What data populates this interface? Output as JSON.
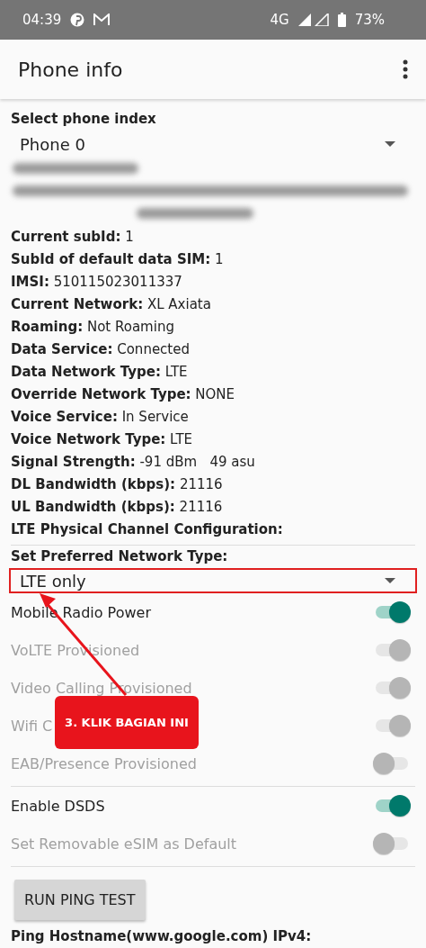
{
  "status_bar": {
    "time": "04:39",
    "network": "4G",
    "battery": "73%"
  },
  "app_bar": {
    "title": "Phone info"
  },
  "phone_index": {
    "label": "Select phone index",
    "value": "Phone 0"
  },
  "info_rows": [
    {
      "text": "**Current subId:** 1"
    },
    {
      "text": "**SubId of default data SIM:** 1"
    },
    {
      "text": "**IMSI:** 510115023011337"
    },
    {
      "text": "**Current Network:** XL Axiata"
    },
    {
      "text": "**Roaming:** Not Roaming"
    },
    {
      "text": "**Data Service:** Connected"
    },
    {
      "text": "**Data Network Type:** LTE"
    },
    {
      "text": "**Override Network Type:** NONE"
    },
    {
      "text": "**Voice Service:** In Service"
    },
    {
      "text": "**Voice Network Type:** LTE"
    },
    {
      "text": "**Signal Strength:** -91 dBm   49 asu"
    },
    {
      "text": "**DL Bandwidth (kbps):** 21116"
    },
    {
      "text": "**UL Bandwidth (kbps):** 21116"
    },
    {
      "text": "**LTE Physical Channel Configuration:**"
    }
  ],
  "preferred_network": {
    "label": "Set Preferred Network Type:",
    "value": "LTE only"
  },
  "toggles": [
    {
      "label": "Mobile Radio Power",
      "on": true,
      "disabled": false,
      "divider": false
    },
    {
      "label": "VoLTE Provisioned",
      "on": true,
      "disabled": true,
      "divider": false
    },
    {
      "label": "Video Calling Provisioned",
      "on": true,
      "disabled": true,
      "divider": false
    },
    {
      "label": "Wifi C",
      "on": true,
      "disabled": true,
      "divider": false
    },
    {
      "label": "EAB/Presence Provisioned",
      "on": false,
      "disabled": true,
      "divider": true
    },
    {
      "label": "Enable DSDS",
      "on": true,
      "disabled": false,
      "divider": false
    },
    {
      "label": "Set Removable eSIM as Default",
      "on": false,
      "disabled": true,
      "divider": true
    }
  ],
  "ping_button": "RUN PING TEST",
  "ping_hostname": "Ping Hostname(www.google.com) IPv4:",
  "callout": {
    "text": "3. KLIK BAGIAN INI"
  }
}
